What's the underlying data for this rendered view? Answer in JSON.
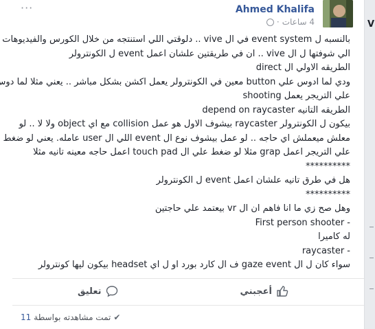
{
  "post": {
    "author": "Ahmed Khalifa",
    "time": "4 ساعات",
    "options_label": "···",
    "lines": [
      "بالنسبه ل event system في ال vive .. دلوقتي اللي استنتجه من خلال الكورس والفيديوهات",
      "الي شوفتها ل ال vive .. ان في طريقتين علشان اعمل event ل الكونترولر",
      "الطريقه الاولي ال direct",
      "ودي لما ادوس علي button معين في الكونترولر يعمل اكشن بشكل مباشر .. يعني مثلا لما دوس",
      "علي التريجر يعمل shooting",
      "الطريقه التانيه depend on raycaster",
      "بيكون ل الكونترولر raycaster بيشوف الاول هو عمل collision مع اي object ولا لا .. لو",
      "معلش ميعملش اي حاجه .. لو عمل بيشوف نوع ال event اللي ال user عامله. يعني لو ضغط",
      "علي التريجر اعمل grap مثلا لو ضغط علي ال touch pad اعمل حاجه معينه تانيه مثلا",
      "**********",
      "هل في طرق تانيه علشان اعمل event ل الكونترولر",
      "**********",
      "وهل صح زي ما انا فاهم ان ال vr بيعتمد علي حاجتين",
      "- First person shooter",
      "له كاميرا",
      "- raycaster",
      "سواء كان ل ال gaze event ف ال كارد بورد او ل اي headset بيكون ليها كونترولر"
    ]
  },
  "actions": {
    "like_label": "أعجبني",
    "comment_label": "تعليق"
  },
  "seen": {
    "text": "تمت مشاهدته بواسطة",
    "count": "11"
  },
  "sidebar_partial": "V"
}
